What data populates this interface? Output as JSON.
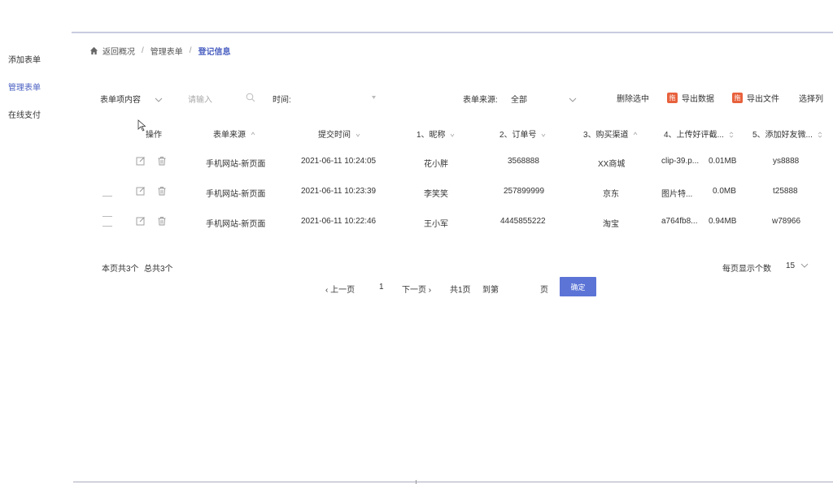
{
  "sidebar": {
    "items": [
      "添加表单",
      "管理表单",
      "在线支付"
    ]
  },
  "breadcrumb": {
    "items": [
      "返回概况",
      "管理表单",
      "登记信息"
    ]
  },
  "filters": {
    "field_select": "表单项内容",
    "search_placeholder": "请输入",
    "time_label": "时间:",
    "source_label": "表单来源:",
    "source_value": "全部"
  },
  "actions": {
    "delete_selected": "删除选中",
    "export_data": "导出数据",
    "export_file": "导出文件",
    "select_columns": "选择列",
    "export_badge": "拖"
  },
  "table": {
    "headers": [
      "操作",
      "表单来源",
      "提交时间",
      "1、昵称",
      "2、订单号",
      "3、购买渠道",
      "4、上传好评截...",
      "5、添加好友微..."
    ],
    "rows": [
      {
        "source": "手机网站-新页面",
        "time": "2021-06-11 10:24:05",
        "nickname": "花小胖",
        "order": "3568888",
        "channel": "XX商城",
        "file": "clip-39.p...",
        "size": "0.01MB",
        "wechat": "ys8888"
      },
      {
        "source": "手机网站-新页面",
        "time": "2021-06-11 10:23:39",
        "nickname": "李笑笑",
        "order": "257899999",
        "channel": "京东",
        "file": "图片特...",
        "size": "0.0MB",
        "wechat": "t25888"
      },
      {
        "source": "手机网站-新页面",
        "time": "2021-06-11 10:22:46",
        "nickname": "王小军",
        "order": "4445855222",
        "channel": "淘宝",
        "file": "a764fb8...",
        "size": "0.94MB",
        "wechat": "w78966"
      }
    ]
  },
  "summary": {
    "page_count": "本页共3个",
    "total_count": "总共3个",
    "per_page_label": "每页显示个数",
    "per_page_value": "15"
  },
  "pagination": {
    "prev": "上一页",
    "current": "1",
    "next": "下一页",
    "total_pages": "共1页",
    "goto_label": "到第",
    "page_unit": "页",
    "confirm": "确定"
  },
  "colors": {
    "accent": "#4a5fc1",
    "button": "#5b74d6",
    "badge": "#e8613c"
  }
}
